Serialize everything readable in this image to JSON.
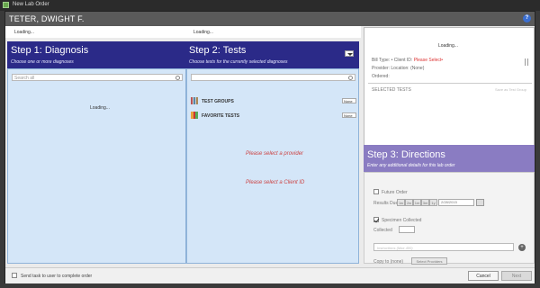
{
  "window": {
    "title": "New Lab Order"
  },
  "patient": {
    "name": "TETER, DWIGHT F."
  },
  "loading_bar": {
    "left": "Loading...",
    "right": "Loading..."
  },
  "step1": {
    "title": "Step 1: Diagnosis",
    "subtitle": "Choose one or more diagnoses",
    "search_placeholder": "Search all",
    "loading": "Loading..."
  },
  "step2": {
    "title": "Step 2: Tests",
    "subtitle": "Choose tests for the currently selected diagnoses",
    "rows": [
      {
        "label": "TEST GROUPS",
        "value": "None"
      },
      {
        "label": "FAVORITE TESTS",
        "value": "None"
      }
    ],
    "messages": [
      "Please select a provider",
      "Please select a Client ID"
    ]
  },
  "right_panel": {
    "loading": "Loading...",
    "bill_type_label": "Bill Type:",
    "bill_type_value": "•",
    "client_id_label": "Client ID:",
    "client_id_value": "Please Select•",
    "provider_label": "Provider:",
    "location_label": "Location:",
    "location_value": "(None)",
    "ordered_label": "Ordered:",
    "selected_tests": "SELECTED TESTS",
    "save_favorite": "Save as Test Group"
  },
  "step3": {
    "title": "Step 3: Directions",
    "subtitle": "Enter any additional details for this lab order",
    "future_order": "Future Order",
    "results_due": "Results Due",
    "segments": [
      "1w",
      "2w",
      "1m",
      "3m",
      "1y"
    ],
    "results_date": "2/28/2015",
    "specimen_collected": "Specimen Collected",
    "collected_label": "Collected",
    "instructions_placeholder": "Instructions (Max 400)",
    "copy_to_label": "Copy to (none)",
    "select_providers": "Select Providers"
  },
  "footer": {
    "send_task": "Send task to user to complete order",
    "cancel": "Cancel",
    "next": "Next"
  }
}
